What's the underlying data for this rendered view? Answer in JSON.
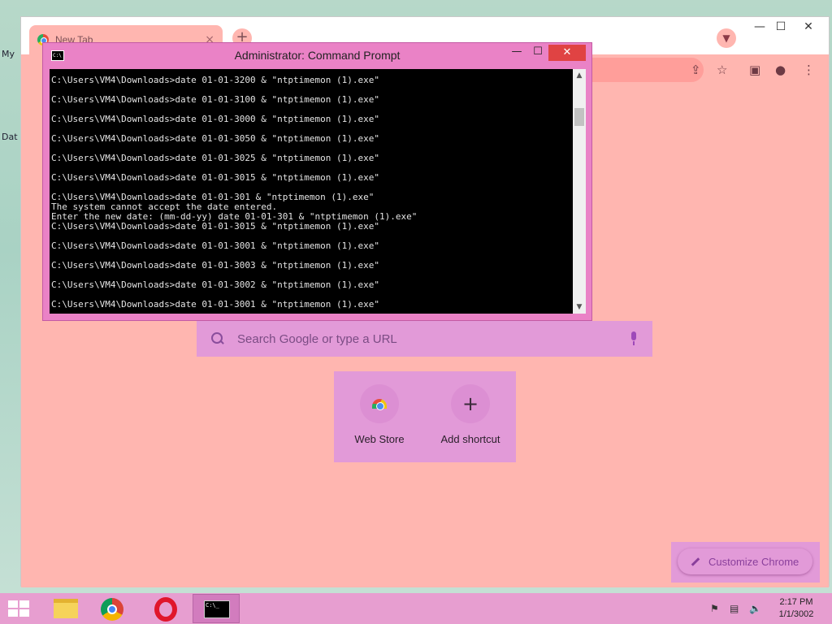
{
  "browser": {
    "tab_title": "New Tab",
    "tab_close": "×",
    "new_tab_symbol": "+",
    "search_placeholder": "Search Google or type a URL",
    "shortcuts": [
      {
        "label": "Web Store"
      },
      {
        "label": "Add shortcut"
      }
    ],
    "customize_label": "Customize Chrome",
    "window_controls": {
      "minimize": "—",
      "maximize": "☐",
      "close": "✕"
    }
  },
  "desktop": {
    "icon_labels": [
      "My",
      "Dat"
    ]
  },
  "cmd": {
    "title": "Administrator: Command Prompt",
    "controls": {
      "minimize": "—",
      "maximize": "☐",
      "close": "✕"
    },
    "lines": [
      "C:\\Users\\VM4\\Downloads>date 01-01-3200 & \"ntptimemon (1).exe\"",
      "",
      "C:\\Users\\VM4\\Downloads>date 01-01-3100 & \"ntptimemon (1).exe\"",
      "",
      "C:\\Users\\VM4\\Downloads>date 01-01-3000 & \"ntptimemon (1).exe\"",
      "",
      "C:\\Users\\VM4\\Downloads>date 01-01-3050 & \"ntptimemon (1).exe\"",
      "",
      "C:\\Users\\VM4\\Downloads>date 01-01-3025 & \"ntptimemon (1).exe\"",
      "",
      "C:\\Users\\VM4\\Downloads>date 01-01-3015 & \"ntptimemon (1).exe\"",
      "",
      "C:\\Users\\VM4\\Downloads>date 01-01-301 & \"ntptimemon (1).exe\"",
      "The system cannot accept the date entered.",
      "Enter the new date: (mm-dd-yy) date 01-01-301 & \"ntptimemon (1).exe\"",
      "C:\\Users\\VM4\\Downloads>date 01-01-3015 & \"ntptimemon (1).exe\"",
      "",
      "C:\\Users\\VM4\\Downloads>date 01-01-3001 & \"ntptimemon (1).exe\"",
      "",
      "C:\\Users\\VM4\\Downloads>date 01-01-3003 & \"ntptimemon (1).exe\"",
      "",
      "C:\\Users\\VM4\\Downloads>date 01-01-3002 & \"ntptimemon (1).exe\"",
      "",
      "C:\\Users\\VM4\\Downloads>date 01-01-3001 & \"ntptimemon (1).exe\""
    ]
  },
  "taskbar": {
    "clock_time": "2:17 PM",
    "clock_date": "1/1/3002"
  }
}
